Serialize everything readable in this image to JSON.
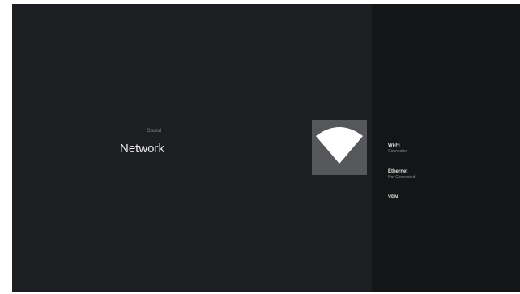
{
  "header": {
    "breadcrumb": "Sound",
    "title": "Network"
  },
  "hero_icon": {
    "name": "wifi-icon"
  },
  "menu": {
    "items": [
      {
        "label": "Wi-Fi",
        "status": "Connected"
      },
      {
        "label": "Ethernet",
        "status": "Not Connected"
      },
      {
        "label": "VPN",
        "status": ""
      }
    ]
  },
  "colors": {
    "background": "#1c1e21",
    "side_panel": "#141516",
    "tile": "#55575a",
    "icon_fill": "#ffffff",
    "text_primary": "#e8e8e8",
    "text_secondary": "#8a8d90"
  }
}
